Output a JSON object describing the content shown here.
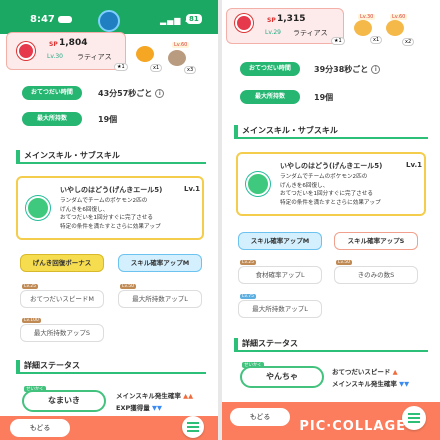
{
  "left": {
    "status": {
      "time": "8:47",
      "signal": "4G",
      "battery": "81"
    },
    "pokemon": {
      "sp_label": "SP",
      "sp": "1,804",
      "level": "Lv.30",
      "name": "ラティアス",
      "stars": "★1"
    },
    "ingredients": [
      {
        "level_tag": "",
        "count": "x1",
        "icon": "pumpkin-icon"
      },
      {
        "level_tag": "Lv.60",
        "count": "x3",
        "icon": "mushroom-icon"
      }
    ],
    "help_time_label": "おてつだい時間",
    "help_time_value": "43分57秒ごと",
    "max_carry_label": "最大所持数",
    "max_carry_value": "19個",
    "main_skill_section": "メインスキル・サブスキル",
    "skill": {
      "name": "いやしのはどう(げんきエール5)",
      "level": "Lv.1",
      "desc1": "ランダムでチームのポケモン2匹の",
      "desc2": "げんきを6回復し、",
      "desc3": "おてつだいを1回分すぐに完了させる",
      "desc4": "特定の条件を満たすとさらに効果アップ"
    },
    "sub_skills": [
      {
        "tag": "",
        "label": "げんき回復ボーナス",
        "style": "yellow"
      },
      {
        "tag": "",
        "label": "スキル確率アップM",
        "style": "blue"
      },
      {
        "tag": "Lv.25",
        "label": "おてつだいスピードM",
        "style": "gray"
      },
      {
        "tag": "Lv.50",
        "label": "最大所持数アップL",
        "style": "gray"
      },
      {
        "tag": "Lv.100",
        "label": "最大所持数アップS",
        "style": "gray"
      }
    ],
    "detail_section": "詳細ステータス",
    "nature_tag": "せいかく",
    "nature": "なまいき",
    "stat_up": "メインスキル発生確率",
    "stat_up_arrows": "▲▲",
    "stat_down": "EXP獲得量",
    "stat_down_arrows": "▼▼",
    "back": "もどる"
  },
  "right": {
    "pokemon": {
      "sp_label": "SP",
      "sp": "1,315",
      "level": "Lv.29",
      "name": "ラティアス",
      "stars": "★1"
    },
    "ingredients": [
      {
        "level_tag": "Lv.30",
        "count": "x1",
        "icon": "pumpkin-icon"
      },
      {
        "level_tag": "Lv.60",
        "count": "x2",
        "icon": "pumpkin-icon"
      }
    ],
    "help_time_label": "おてつだい時間",
    "help_time_value": "39分38秒ごと",
    "max_carry_label": "最大所持数",
    "max_carry_value": "19個",
    "main_skill_section": "メインスキル・サブスキル",
    "skill": {
      "name": "いやしのはどう(げんきエール5)",
      "level": "Lv.1",
      "desc1": "ランダムでチームのポケモン2匹の",
      "desc2": "げんきを6回復し、",
      "desc3": "おてつだいを1回分すぐに完了させる",
      "desc4": "特定の条件を満たすとさらに効果アップ"
    },
    "sub_skills": [
      {
        "tag": "",
        "label": "スキル確率アップM",
        "style": "blue"
      },
      {
        "tag": "",
        "label": "スキル確率アップS",
        "style": "red"
      },
      {
        "tag": "Lv.25",
        "label": "食材確率アップL",
        "style": "gray"
      },
      {
        "tag": "Lv.50",
        "label": "きのみの数S",
        "style": "gray"
      },
      {
        "tag": "Lv.75",
        "label": "最大所持数アップL",
        "style": "gray"
      }
    ],
    "detail_section": "詳細ステータス",
    "nature_tag": "せいかく",
    "nature": "やんちゃ",
    "stat_up": "おてつだいスピード",
    "stat_up_arrows": "▲",
    "stat_down": "メインスキル発生確率",
    "stat_down_arrows": "▼▼",
    "back": "もどる",
    "watermark": "PIC·COLLAGE"
  }
}
